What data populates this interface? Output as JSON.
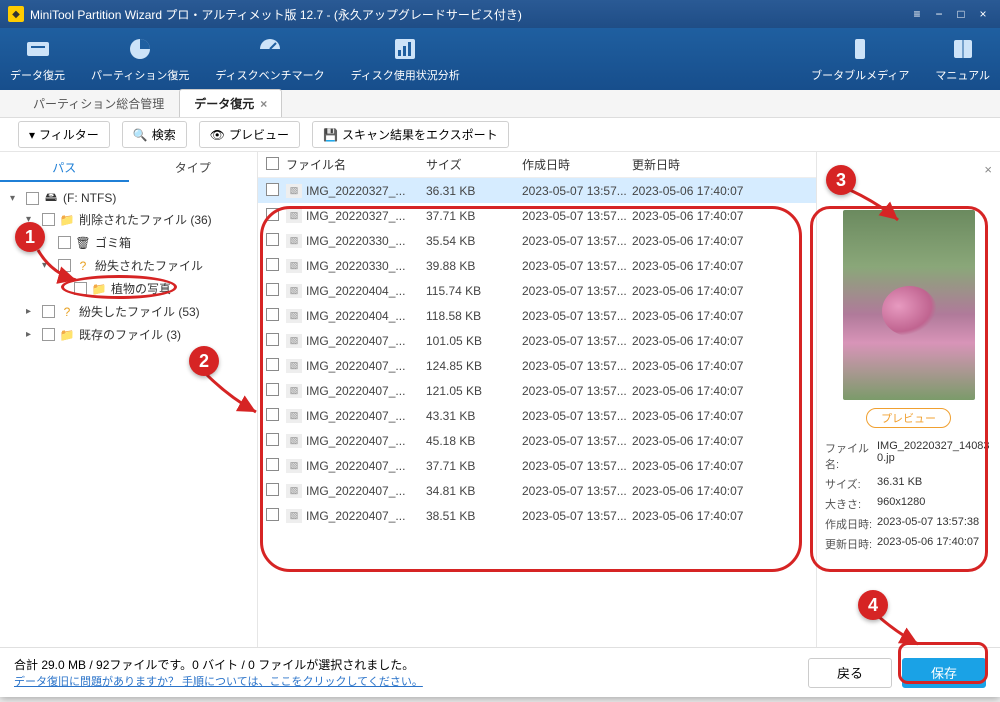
{
  "window": {
    "title": "MiniTool Partition Wizard プロ・アルティメット版 12.7 - (永久アップグレードサービス付き)"
  },
  "ribbon": {
    "items": [
      {
        "label": "データ復元",
        "icon": "recovery-icon"
      },
      {
        "label": "パーティション復元",
        "icon": "partition-icon"
      },
      {
        "label": "ディスクベンチマーク",
        "icon": "benchmark-icon"
      },
      {
        "label": "ディスク使用状況分析",
        "icon": "analysis-icon"
      }
    ],
    "right": [
      {
        "label": "ブータブルメディア",
        "icon": "bootmedia-icon"
      },
      {
        "label": "マニュアル",
        "icon": "manual-icon"
      }
    ]
  },
  "tabs": {
    "items": [
      {
        "label": "パーティション総合管理",
        "active": false
      },
      {
        "label": "データ復元",
        "active": true,
        "closable": true
      }
    ]
  },
  "subbar": {
    "filter": "フィルター",
    "search": "検索",
    "preview": "プレビュー",
    "export": "スキャン結果をエクスポート"
  },
  "left_tabs": {
    "path": "パス",
    "type": "タイプ"
  },
  "tree": {
    "root": "(F: NTFS)",
    "nodes": [
      {
        "label": "削除されたファイル (36)"
      },
      {
        "label": "ゴミ箱"
      },
      {
        "label": "紛失されたファイル"
      },
      {
        "label": "植物の写真"
      },
      {
        "label": "紛失したファイル (53)"
      },
      {
        "label": "既存のファイル (3)"
      }
    ]
  },
  "columns": {
    "name": "ファイル名",
    "size": "サイズ",
    "created": "作成日時",
    "modified": "更新日時"
  },
  "files": [
    {
      "name": "IMG_20220327_...",
      "size": "36.31 KB",
      "created": "2023-05-07 13:57...",
      "modified": "2023-05-06 17:40:07",
      "selected": true
    },
    {
      "name": "IMG_20220327_...",
      "size": "37.71 KB",
      "created": "2023-05-07 13:57...",
      "modified": "2023-05-06 17:40:07"
    },
    {
      "name": "IMG_20220330_...",
      "size": "35.54 KB",
      "created": "2023-05-07 13:57...",
      "modified": "2023-05-06 17:40:07"
    },
    {
      "name": "IMG_20220330_...",
      "size": "39.88 KB",
      "created": "2023-05-07 13:57...",
      "modified": "2023-05-06 17:40:07"
    },
    {
      "name": "IMG_20220404_...",
      "size": "115.74 KB",
      "created": "2023-05-07 13:57...",
      "modified": "2023-05-06 17:40:07"
    },
    {
      "name": "IMG_20220404_...",
      "size": "118.58 KB",
      "created": "2023-05-07 13:57...",
      "modified": "2023-05-06 17:40:07"
    },
    {
      "name": "IMG_20220407_...",
      "size": "101.05 KB",
      "created": "2023-05-07 13:57...",
      "modified": "2023-05-06 17:40:07"
    },
    {
      "name": "IMG_20220407_...",
      "size": "124.85 KB",
      "created": "2023-05-07 13:57...",
      "modified": "2023-05-06 17:40:07"
    },
    {
      "name": "IMG_20220407_...",
      "size": "121.05 KB",
      "created": "2023-05-07 13:57...",
      "modified": "2023-05-06 17:40:07"
    },
    {
      "name": "IMG_20220407_...",
      "size": "43.31 KB",
      "created": "2023-05-07 13:57...",
      "modified": "2023-05-06 17:40:07"
    },
    {
      "name": "IMG_20220407_...",
      "size": "45.18 KB",
      "created": "2023-05-07 13:57...",
      "modified": "2023-05-06 17:40:07"
    },
    {
      "name": "IMG_20220407_...",
      "size": "37.71 KB",
      "created": "2023-05-07 13:57...",
      "modified": "2023-05-06 17:40:07"
    },
    {
      "name": "IMG_20220407_...",
      "size": "34.81 KB",
      "created": "2023-05-07 13:57...",
      "modified": "2023-05-06 17:40:07"
    },
    {
      "name": "IMG_20220407_...",
      "size": "38.51 KB",
      "created": "2023-05-07 13:57...",
      "modified": "2023-05-06 17:40:07"
    }
  ],
  "preview": {
    "button": "プレビュー",
    "meta": {
      "name_k": "ファイル名:",
      "name_v": "IMG_20220327_140830.jp",
      "size_k": "サイズ:",
      "size_v": "36.31 KB",
      "dim_k": "大きさ:",
      "dim_v": "960x1280",
      "created_k": "作成日時:",
      "created_v": "2023-05-07 13:57:38",
      "modified_k": "更新日時:",
      "modified_v": "2023-05-06 17:40:07"
    }
  },
  "footer": {
    "status": "合計 29.0 MB / 92ファイルです。0 バイト / 0 ファイルが選択されました。",
    "link": "データ復旧に問題がありますか？ 手順については、ここをクリックしてください。",
    "back": "戻る",
    "save": "保存"
  },
  "callouts": [
    "1",
    "2",
    "3",
    "4"
  ]
}
